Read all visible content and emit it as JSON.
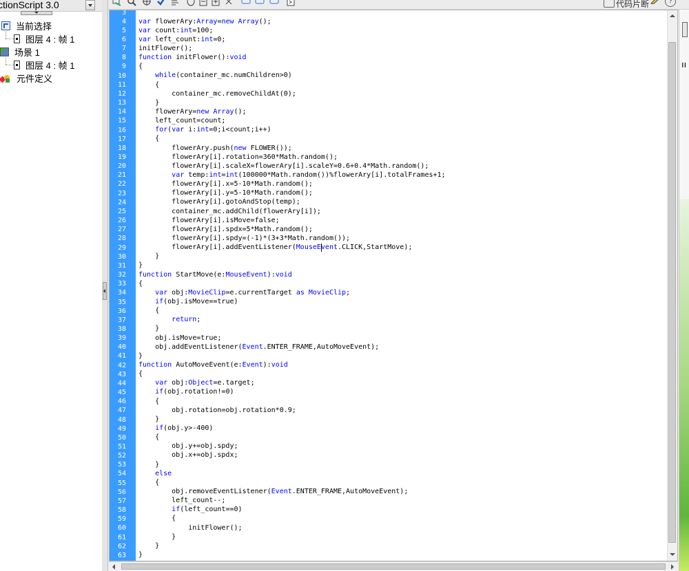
{
  "left_panel": {
    "version": "ctionScript 3.0",
    "tree": {
      "current_selection": "当前选择",
      "layer_current": "图层 4 : 帧 1",
      "scene": "场景 1",
      "layer_scene": "图层 4 : 帧 1",
      "symbol_definitions": "元件定义"
    }
  },
  "toolbar": {
    "code_snippets": "代码片断",
    "help_glyph": "?"
  },
  "right_panel": {
    "partial_char": "ıı"
  },
  "editor": {
    "line_numbers": [
      "3",
      "4",
      "5",
      "6",
      "7",
      "8",
      "9",
      "10",
      "11",
      "12",
      "13",
      "14",
      "15",
      "16",
      "17",
      "18",
      "19",
      "20",
      "21",
      "22",
      "23",
      "24",
      "25",
      "26",
      "27",
      "28",
      "29",
      "30",
      "31",
      "32",
      "33",
      "34",
      "35",
      "36",
      "37",
      "38",
      "39",
      "40",
      "41",
      "42",
      "43",
      "44",
      "45",
      "46",
      "47",
      "48",
      "49",
      "50",
      "51",
      "52",
      "53",
      "54",
      "55",
      "56",
      "57",
      "58",
      "59",
      "60",
      "61",
      "62",
      "63"
    ],
    "lines": [
      "",
      "var flowerAry:Array=new Array();",
      "var count:int=100;",
      "var left_count:int=0;",
      "initFlower();",
      "function initFlower():void",
      "{",
      "    while(container_mc.numChildren>0)",
      "    {",
      "        container_mc.removeChildAt(0);",
      "    }",
      "    flowerAry=new Array();",
      "    left_count=count;",
      "    for(var i:int=0;i<count;i++)",
      "    {",
      "        flowerAry.push(new FLOWER());",
      "        flowerAry[i].rotation=360*Math.random();",
      "        flowerAry[i].scaleX=flowerAry[i].scaleY=0.6+0.4*Math.random();",
      "        var temp:int=int(100000*Math.random())%flowerAry[i].totalFrames+1;",
      "        flowerAry[i].x=5-10*Math.random();",
      "        flowerAry[i].y=5-10*Math.random();",
      "        flowerAry[i].gotoAndStop(temp);",
      "        container_mc.addChild(flowerAry[i]);",
      "        flowerAry[i].isMove=false;",
      "        flowerAry[i].spdx=5*Math.random();",
      "        flowerAry[i].spdy=(-1)*(3+3*Math.random());",
      "        flowerAry[i].addEventListener(MouseEvent.CLICK,StartMove);",
      "    }",
      "}",
      "function StartMove(e:MouseEvent):void",
      "{",
      "    var obj:MovieClip=e.currentTarget as MovieClip;",
      "    if(obj.isMove==true)",
      "    {",
      "        return;",
      "    }",
      "    obj.isMove=true;",
      "    obj.addEventListener(Event.ENTER_FRAME,AutoMoveEvent);",
      "}",
      "function AutoMoveEvent(e:Event):void",
      "{",
      "    var obj:Object=e.target;",
      "    if(obj.rotation!=0)",
      "    {",
      "        obj.rotation=obj.rotation*0.9;",
      "    }",
      "    if(obj.y>-400)",
      "    {",
      "        obj.y+=obj.spdy;",
      "        obj.x+=obj.spdx;",
      "    }",
      "    else",
      "    {",
      "        obj.removeEventListener(Event.ENTER_FRAME,AutoMoveEvent);",
      "        left_count--;",
      "        if(left_count==0)",
      "        {",
      "            initFlower();",
      "        }",
      "    }",
      "}"
    ]
  },
  "colors": {
    "gutter": "#3b9cff",
    "keyword": "#0000ff",
    "type": "#0000ff"
  },
  "icons": [
    "find-replace-icon",
    "search-icon",
    "target-icon",
    "check-syntax-icon",
    "format-icon",
    "debug-icon",
    "collapse-icon",
    "expand-icon",
    "comment-icon",
    "balloon-icon",
    "snippet-icon",
    "pencil-icon",
    "help-icon"
  ]
}
